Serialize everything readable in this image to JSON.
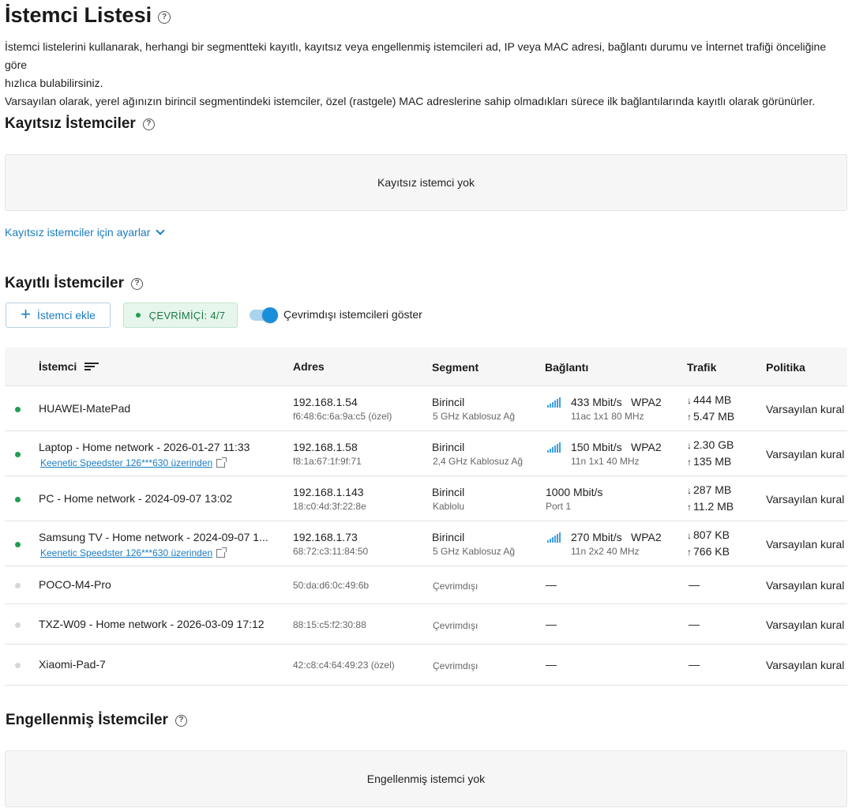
{
  "page": {
    "title": "İstemci Listesi",
    "desc1": "İstemci listelerini kullanarak, herhangi bir segmentteki kayıtlı, kayıtsız veya engellenmiş istemcileri ad, IP veya MAC adresi, bağlantı durumu ve İnternet trafiği önceliğine göre",
    "desc2": "hızlıca bulabilirsiniz.",
    "desc3": "Varsayılan olarak, yerel ağınızın birincil segmentindeki istemciler, özel (rastgele) MAC adreslerine sahip olmadıkları sürece ilk bağlantılarında kayıtlı olarak görünürler."
  },
  "unregistered": {
    "title": "Kayıtsız İstemciler",
    "empty": "Kayıtsız istemci yok",
    "settings_link": "Kayıtsız istemciler için ayarlar"
  },
  "registered": {
    "title": "Kayıtlı İstemciler",
    "add_button": "İstemci ekle",
    "online_badge": "ÇEVRİMİÇİ: 4/7",
    "toggle_label": "Çevrimdışı istemcileri göster",
    "toggle_on": true,
    "columns": {
      "client": "İstemci",
      "address": "Adres",
      "segment": "Segment",
      "connection": "Bağlantı",
      "traffic": "Trafik",
      "policy": "Politika"
    },
    "rows": [
      {
        "name": "HUAWEI-MatePad",
        "via": "",
        "ip": "192.168.1.54",
        "mac": "f6:48:6c:6a:9a:c5 (özel)",
        "segment": "Birincil",
        "segment_sub": "5 GHz Kablosuz Ağ",
        "speed": "433 Mbit/s",
        "security": "WPA2",
        "conn_sub": "11ac 1x1 80 MHz",
        "down": "444 MB",
        "up": "5.47 MB",
        "policy": "Varsayılan kural",
        "online": true,
        "wifi": true
      },
      {
        "name": "Laptop - Home network - 2026-01-27 11:33",
        "via": "Keenetic Speedster 126***630 üzerinden",
        "ip": "192.168.1.58",
        "mac": "f8:1a:67:1f:9f:71",
        "segment": "Birincil",
        "segment_sub": "2,4 GHz Kablosuz Ağ",
        "speed": "150 Mbit/s",
        "security": "WPA2",
        "conn_sub": "11n 1x1 40 MHz",
        "down": "2.30 GB",
        "up": "135 MB",
        "policy": "Varsayılan kural",
        "online": true,
        "wifi": true
      },
      {
        "name": "PC - Home network - 2024-09-07 13:02",
        "via": "",
        "ip": "192.168.1.143",
        "mac": "18:c0:4d:3f:22:8e",
        "segment": "Birincil",
        "segment_sub": "Kablolu",
        "speed": "1000 Mbit/s",
        "security": "",
        "conn_sub": "Port 1",
        "down": "287 MB",
        "up": "11.2 MB",
        "policy": "Varsayılan kural",
        "online": true,
        "wifi": false
      },
      {
        "name": "Samsung TV - Home network - 2024-09-07 1...",
        "via": "Keenetic Speedster 126***630 üzerinden",
        "ip": "192.168.1.73",
        "mac": "68:72:c3:11:84:50",
        "segment": "Birincil",
        "segment_sub": "5 GHz Kablosuz Ağ",
        "speed": "270 Mbit/s",
        "security": "WPA2",
        "conn_sub": "11n 2x2 40 MHz",
        "down": "807 KB",
        "up": "766 KB",
        "policy": "Varsayılan kural",
        "online": true,
        "wifi": true
      },
      {
        "name": "POCO-M4-Pro",
        "via": "",
        "ip": "",
        "mac": "50:da:d6:0c:49:6b",
        "segment": "",
        "segment_sub": "Çevrimdışı",
        "speed": "—",
        "security": "",
        "conn_sub": "",
        "down": "",
        "up": "",
        "traffic_dash": "—",
        "policy": "Varsayılan kural",
        "online": false,
        "wifi": false
      },
      {
        "name": "TXZ-W09 - Home network - 2026-03-09 17:12",
        "via": "",
        "ip": "",
        "mac": "88:15:c5:f2:30:88",
        "segment": "",
        "segment_sub": "Çevrimdışı",
        "speed": "—",
        "security": "",
        "conn_sub": "",
        "down": "",
        "up": "",
        "traffic_dash": "—",
        "policy": "Varsayılan kural",
        "online": false,
        "wifi": false
      },
      {
        "name": "Xiaomi-Pad-7",
        "via": "",
        "ip": "",
        "mac": "42:c8:c4:64:49:23 (özel)",
        "segment": "",
        "segment_sub": "Çevrimdışı",
        "speed": "—",
        "security": "",
        "conn_sub": "",
        "down": "",
        "up": "",
        "traffic_dash": "—",
        "policy": "Varsayılan kural",
        "online": false,
        "wifi": false
      }
    ]
  },
  "blocked": {
    "title": "Engellenmiş İstemciler",
    "empty": "Engellenmiş istemci yok"
  },
  "colors": {
    "accent": "#1a7dc0",
    "online": "#1e9e52",
    "offline": "#d6d6d6"
  }
}
